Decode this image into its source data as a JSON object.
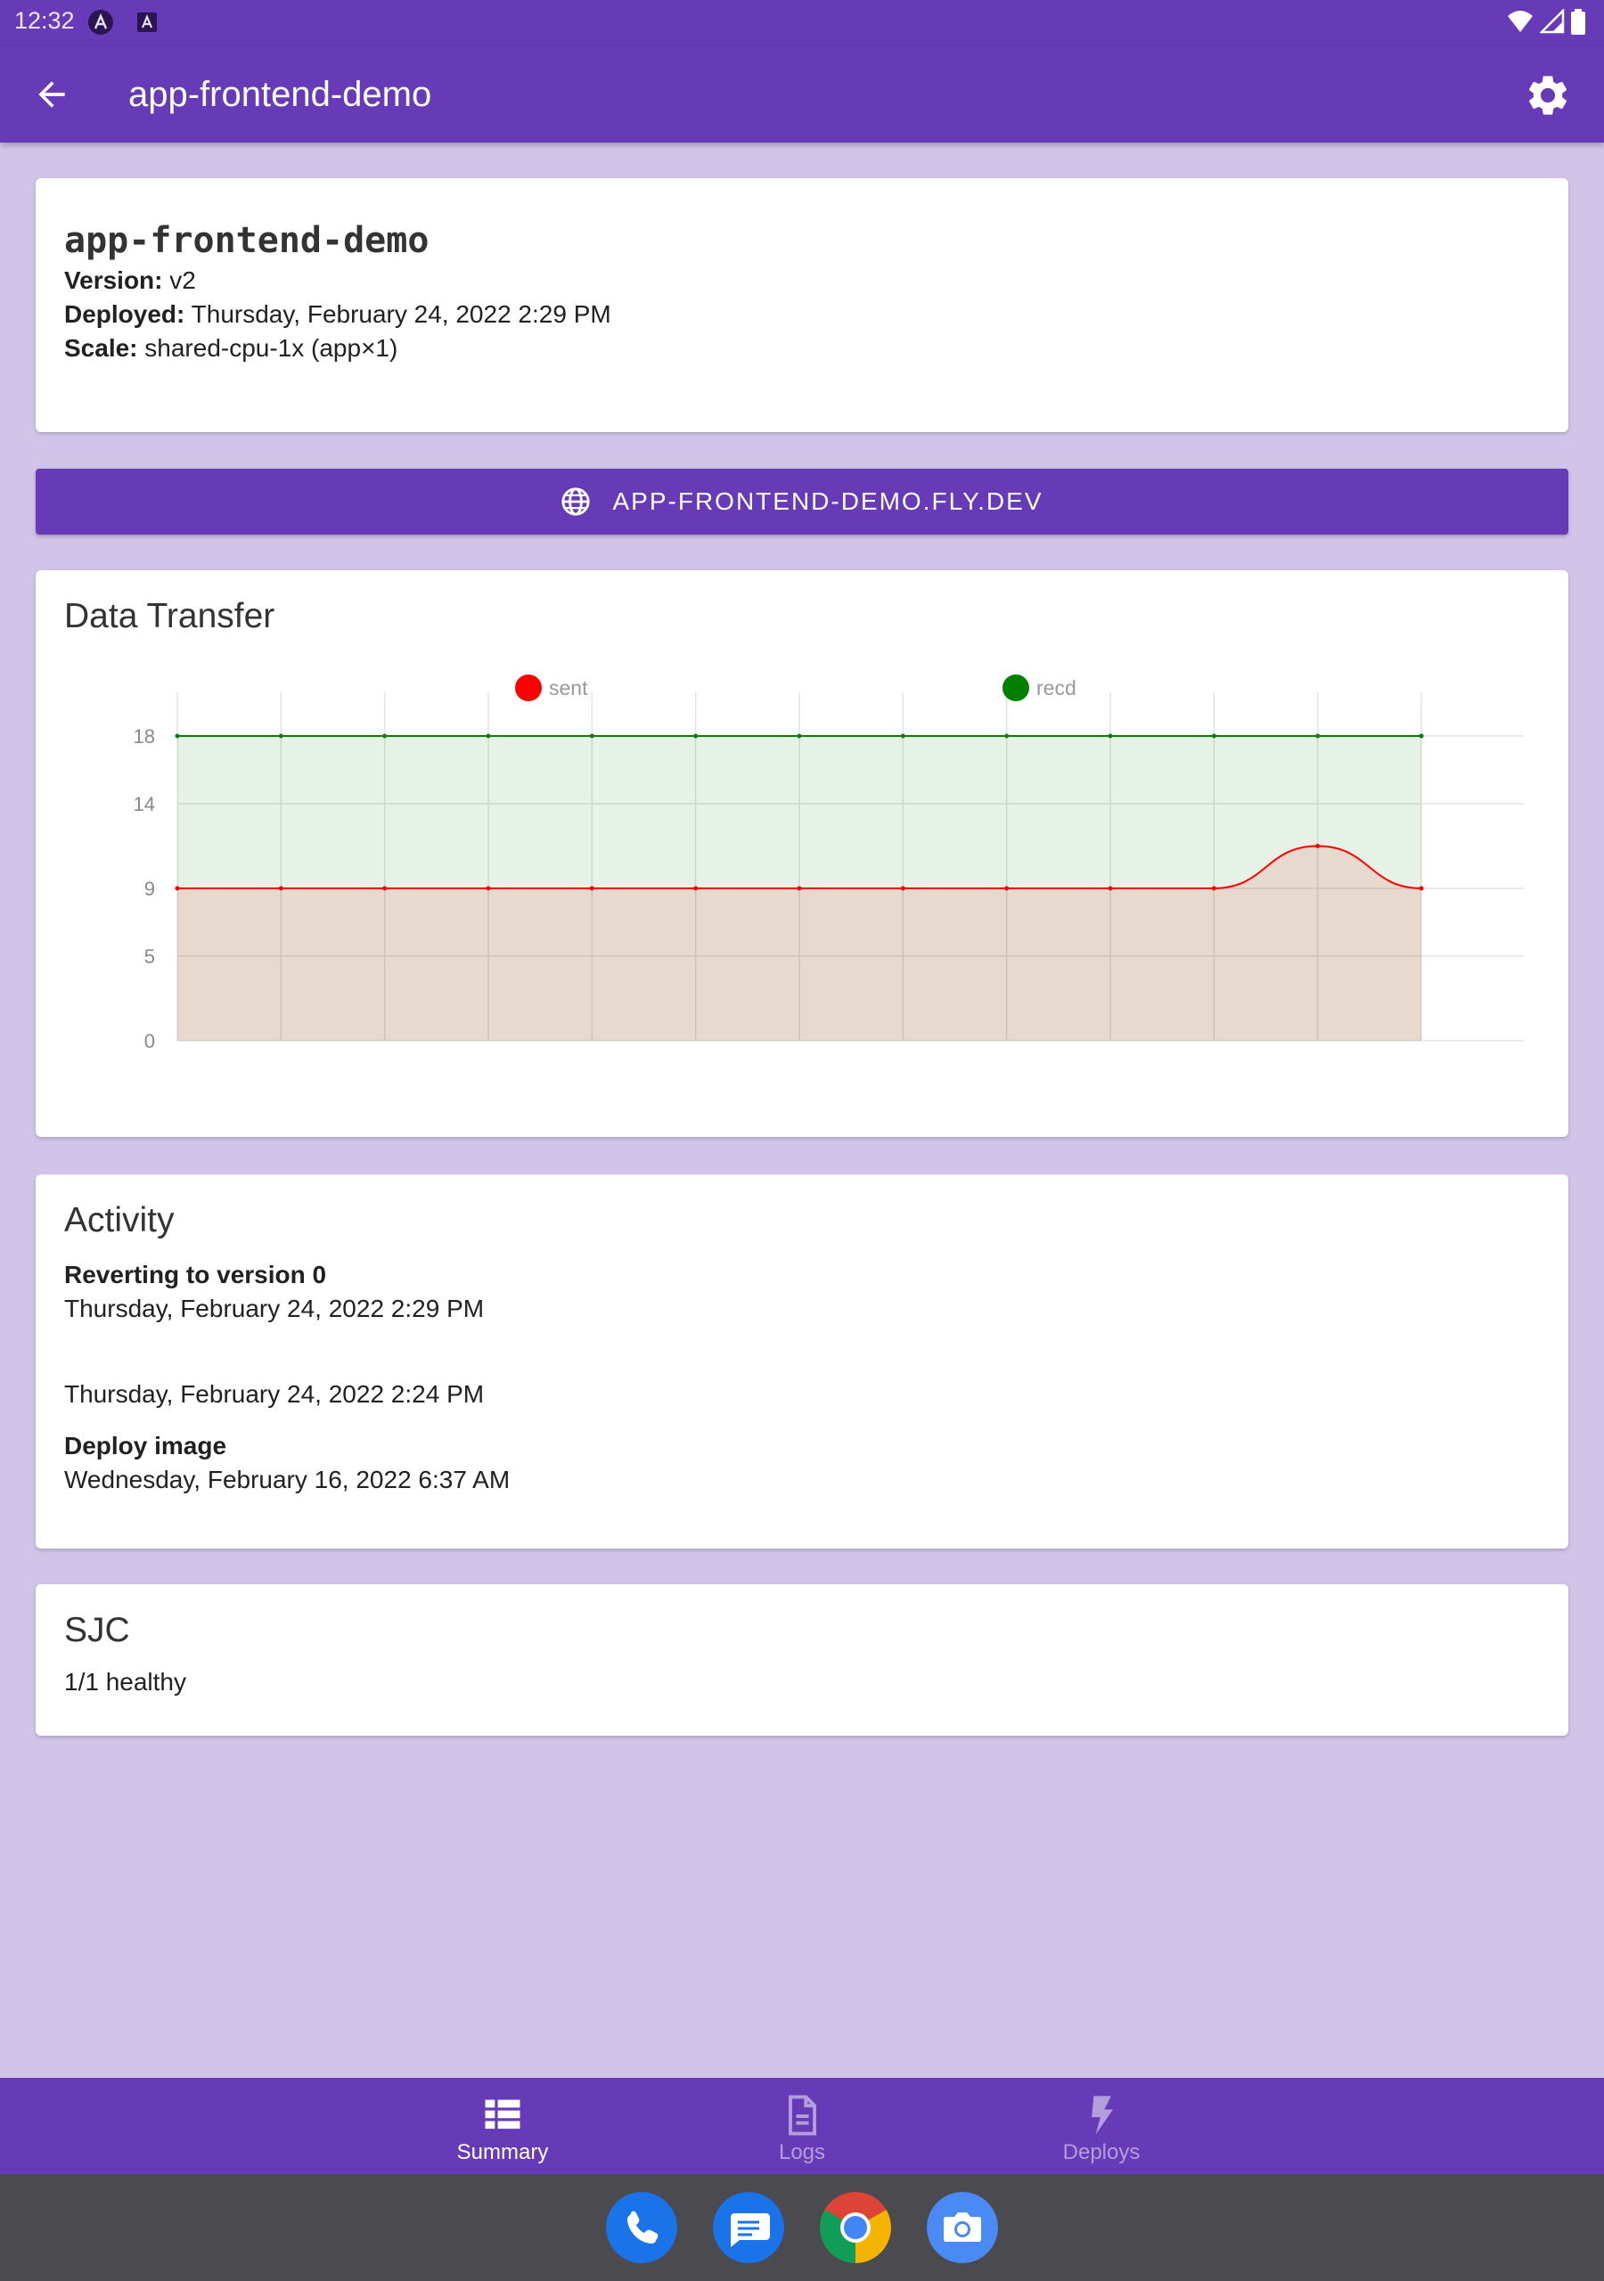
{
  "status_bar": {
    "time": "12:32"
  },
  "app_bar": {
    "title": "app-frontend-demo",
    "back_icon": "arrow-left-icon",
    "settings_icon": "gear-icon"
  },
  "info": {
    "name": "app-frontend-demo",
    "version_label": "Version:",
    "version_value": "v2",
    "deployed_label": "Deployed:",
    "deployed_value": "Thursday, February 24, 2022 2:29 PM",
    "scale_label": "Scale:",
    "scale_value": "shared-cpu-1x (app×1)"
  },
  "link_button": {
    "label": "APP-FRONTEND-DEMO.FLY.DEV",
    "icon": "globe-icon"
  },
  "chart_card": {
    "title": "Data Transfer"
  },
  "chart_data": {
    "type": "area",
    "title": "Data Transfer",
    "series": [
      {
        "name": "sent",
        "color": "#ff0000",
        "values": [
          9,
          9,
          9,
          9,
          9,
          9,
          9,
          9,
          9,
          9,
          9,
          11.5,
          9
        ]
      },
      {
        "name": "recd",
        "color": "#008000",
        "values": [
          18,
          18,
          18,
          18,
          18,
          18,
          18,
          18,
          18,
          18,
          18,
          18,
          18
        ]
      }
    ],
    "y_ticks": [
      0,
      5,
      9,
      14,
      18
    ],
    "ylim": [
      0,
      20
    ],
    "grid": true,
    "legend": "top"
  },
  "activity": {
    "title": "Activity",
    "items": [
      {
        "title": "Reverting to version 0",
        "date": "Thursday, February 24, 2022 2:29 PM"
      },
      {
        "title": "",
        "date": "Thursday, February 24, 2022 2:24 PM"
      },
      {
        "title": "Deploy image",
        "date": "Wednesday, February 16, 2022 6:37 AM"
      }
    ]
  },
  "region": {
    "title": "SJC",
    "status": "1/1 healthy"
  },
  "bottom_nav": {
    "items": [
      {
        "label": "Summary",
        "icon": "table-icon",
        "active": true
      },
      {
        "label": "Logs",
        "icon": "document-icon",
        "active": false
      },
      {
        "label": "Deploys",
        "icon": "lightning-icon",
        "active": false
      }
    ]
  },
  "dock": {
    "apps": [
      "phone-icon",
      "messages-icon",
      "chrome-icon",
      "camera-icon"
    ]
  },
  "colors": {
    "primary": "#673ab7",
    "background": "#d1c4e9",
    "sent": "#ff0000",
    "recd": "#008000"
  }
}
